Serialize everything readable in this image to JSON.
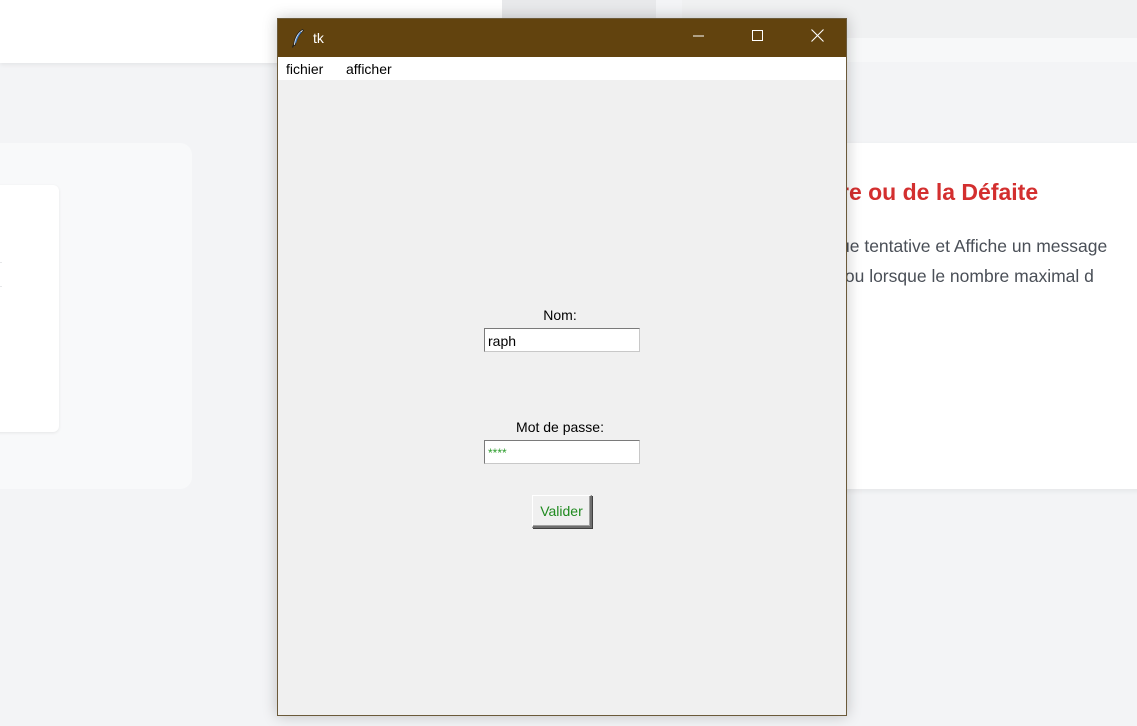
{
  "background_page": {
    "card_title": "re ou de la Défaite",
    "paragraph_lines": [
      "ue tentative et Affiche un message",
      " ou lorsque le nombre maximal d"
    ],
    "title_color": "#d32f2f"
  },
  "window": {
    "title": "tk",
    "titlebar_color": "#62430e",
    "app_icon": "tk-feather-icon",
    "controls": {
      "minimize_icon": "minimize-icon",
      "maximize_icon": "maximize-icon",
      "close_icon": "close-icon"
    }
  },
  "menubar": {
    "items": [
      {
        "label": "fichier"
      },
      {
        "label": "afficher"
      }
    ]
  },
  "form": {
    "nom_label": "Nom:",
    "nom_value": "raph",
    "password_label": "Mot de passe:",
    "password_value": "****",
    "submit_label": "Valider",
    "submit_color": "#1f8a1f",
    "password_text_color": "#2e9d2e"
  }
}
